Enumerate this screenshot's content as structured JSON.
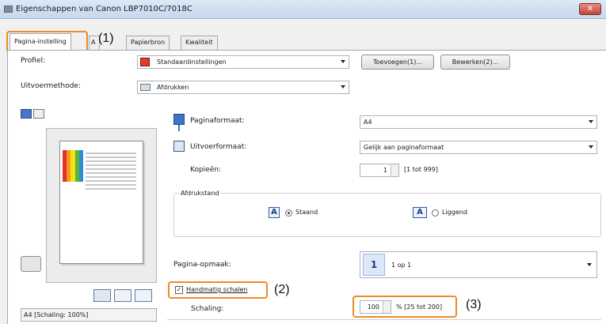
{
  "window": {
    "title": "Eigenschappen van Canon LBP7010C/7018C",
    "close_glyph": "✕"
  },
  "tabs": [
    {
      "label": "Pagina-instelling"
    },
    {
      "label": "A"
    },
    {
      "label": "Papierbron"
    },
    {
      "label": "Kwaliteit"
    }
  ],
  "callouts": {
    "c1": "(1)",
    "c2": "(2)",
    "c3": "(3)"
  },
  "profile": {
    "label": "Profiel:",
    "value": "Standaardinstellingen",
    "add_button": "Toevoegen(1)...",
    "edit_button": "Bewerken(2)..."
  },
  "output_method": {
    "label": "Uitvoermethode:",
    "value": "Afdrukken"
  },
  "paper_size": {
    "label": "Paginaformaat:",
    "value": "A4"
  },
  "output_size": {
    "label": "Uitvoerformaat:",
    "value": "Gelijk aan paginaformaat"
  },
  "copies": {
    "label": "Kopieën:",
    "value": "1",
    "range": "[1 tot 999]"
  },
  "orientation": {
    "title": "Afdrukstand",
    "options": [
      "Staand",
      "Liggend"
    ],
    "selected": "Staand",
    "icon_letter": "A"
  },
  "page_layout": {
    "label": "Pagina-opmaak:",
    "value": "1 op 1",
    "glyph": "1"
  },
  "manual_scaling": {
    "label": "Handmatig schalen",
    "checked": true,
    "check_glyph": "✓"
  },
  "scaling": {
    "label": "Schaling:",
    "value": "100",
    "range": "% [25 tot 200]"
  },
  "preview": {
    "status": "A4 [Schaling: 100%]"
  },
  "colors": {
    "highlight": "#ee8b23",
    "accent": "#1d4e9b"
  }
}
